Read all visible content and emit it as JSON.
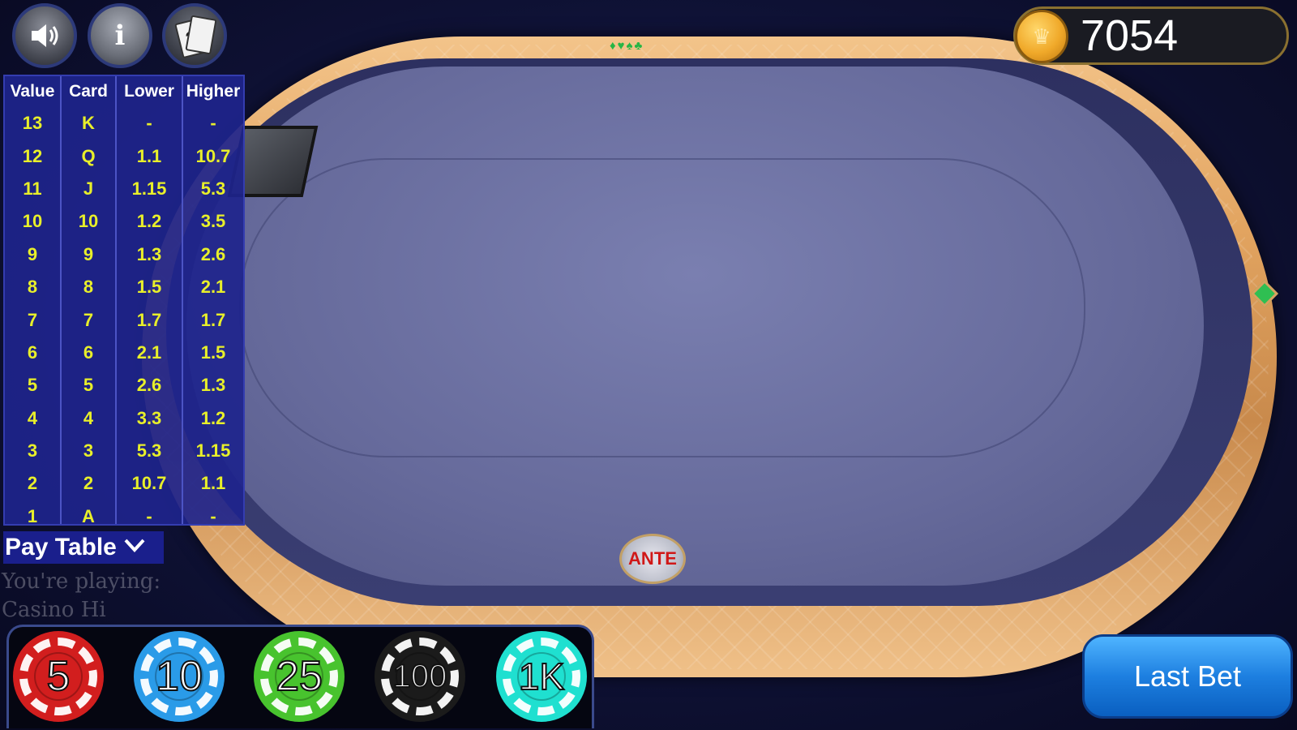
{
  "top_bar": {
    "sound_icon": "speaker-icon",
    "info_label": "i",
    "cards_icon_label": "?",
    "coins": "7054"
  },
  "table": {
    "suits": "♦♥♠♣",
    "ante_label": "ANTE"
  },
  "paytable": {
    "headers": [
      "Value",
      "Card",
      "Lower",
      "Higher"
    ],
    "rows": [
      [
        "13",
        "K",
        "-",
        "-"
      ],
      [
        "12",
        "Q",
        "1.1",
        "10.7"
      ],
      [
        "11",
        "J",
        "1.15",
        "5.3"
      ],
      [
        "10",
        "10",
        "1.2",
        "3.5"
      ],
      [
        "9",
        "9",
        "1.3",
        "2.6"
      ],
      [
        "8",
        "8",
        "1.5",
        "2.1"
      ],
      [
        "7",
        "7",
        "1.7",
        "1.7"
      ],
      [
        "6",
        "6",
        "2.1",
        "1.5"
      ],
      [
        "5",
        "5",
        "2.6",
        "1.3"
      ],
      [
        "4",
        "4",
        "3.3",
        "1.2"
      ],
      [
        "3",
        "3",
        "5.3",
        "1.15"
      ],
      [
        "2",
        "2",
        "10.7",
        "1.1"
      ],
      [
        "1",
        "A",
        "-",
        "-"
      ]
    ],
    "toggle_label": "Pay Table"
  },
  "playing": {
    "line1": "You're playing:",
    "line2": "Casino Hi"
  },
  "chips": [
    "5",
    "10",
    "25",
    "100",
    "1K"
  ],
  "last_bet_label": "Last Bet",
  "colors": {
    "paytable_bg": "#1e248c",
    "paytable_value": "#e8ef2a",
    "felt": "#6a6e9f",
    "rail": "#e2a460",
    "last_bet": "#1d7fe0"
  }
}
